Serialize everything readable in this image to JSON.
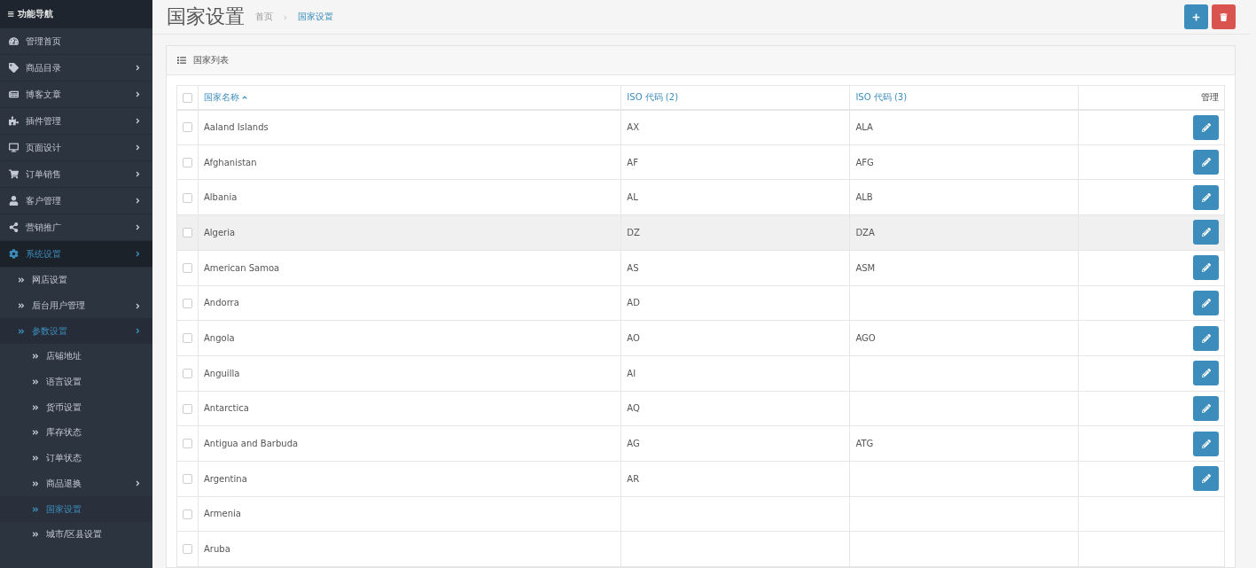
{
  "sidebar": {
    "title": "≡ 功能导航",
    "items": [
      {
        "label": "管理首页",
        "has_arrow": false,
        "selected": false
      },
      {
        "label": "商品目录",
        "has_arrow": true,
        "selected": false
      },
      {
        "label": "博客文章",
        "has_arrow": true,
        "selected": false
      },
      {
        "label": "插件管理",
        "has_arrow": true,
        "selected": false
      },
      {
        "label": "页面设计",
        "has_arrow": true,
        "selected": false
      },
      {
        "label": "订单销售",
        "has_arrow": true,
        "selected": false
      },
      {
        "label": "客户管理",
        "has_arrow": true,
        "selected": false
      },
      {
        "label": "营销推广",
        "has_arrow": true,
        "selected": false
      },
      {
        "label": "系统设置",
        "has_arrow": true,
        "selected": true,
        "children": [
          {
            "label": "网店设置",
            "has_arrow": false,
            "selected": false
          },
          {
            "label": "后台用户管理",
            "has_arrow": true,
            "selected": false
          },
          {
            "label": "参数设置",
            "has_arrow": true,
            "selected": true,
            "children": [
              {
                "label": "店铺地址",
                "has_arrow": false,
                "selected": false
              },
              {
                "label": "语言设置",
                "has_arrow": false,
                "selected": false
              },
              {
                "label": "货币设置",
                "has_arrow": false,
                "selected": false
              },
              {
                "label": "库存状态",
                "has_arrow": false,
                "selected": false
              },
              {
                "label": "订单状态",
                "has_arrow": false,
                "selected": false
              },
              {
                "label": "商品退换",
                "has_arrow": true,
                "selected": false
              },
              {
                "label": "国家设置",
                "has_arrow": false,
                "selected": true
              },
              {
                "label": "城市/区县设置",
                "has_arrow": false,
                "selected": false
              }
            ]
          }
        ]
      }
    ]
  },
  "header": {
    "title": "国家设置",
    "separator": "›",
    "breadcrumb": [
      {
        "label": "首页",
        "selected": false
      },
      {
        "label": "国家设置",
        "selected": true
      }
    ]
  },
  "panel": {
    "title": "国家列表",
    "table": {
      "all_checked": false,
      "columns": [
        {
          "label": "国家名称",
          "sorted": true
        },
        {
          "label": "ISO 代码 (2)",
          "sorted": false
        },
        {
          "label": "ISO 代码 (3)",
          "sorted": false
        },
        {
          "label": "管理",
          "sorted": false
        }
      ],
      "rows": [
        {
          "name": "Aaland Islands",
          "iso2": "AX",
          "iso3": "ALA",
          "checked": false,
          "hovered": false
        },
        {
          "name": "Afghanistan",
          "iso2": "AF",
          "iso3": "AFG",
          "checked": false,
          "hovered": false
        },
        {
          "name": "Albania",
          "iso2": "AL",
          "iso3": "ALB",
          "checked": false,
          "hovered": false
        },
        {
          "name": "Algeria",
          "iso2": "DZ",
          "iso3": "DZA",
          "checked": false,
          "hovered": true
        },
        {
          "name": "American Samoa",
          "iso2": "AS",
          "iso3": "ASM",
          "checked": false,
          "hovered": false
        },
        {
          "name": "Andorra",
          "iso2": "AD",
          "checked": false,
          "hovered": false
        },
        {
          "name": "Angola",
          "iso2": "AO",
          "iso3": "AGO",
          "checked": false,
          "hovered": false
        },
        {
          "name": "Anguilla",
          "iso2": "AI",
          "checked": false,
          "hovered": false
        },
        {
          "name": "Antarctica",
          "iso2": "AQ",
          "checked": false,
          "hovered": false
        },
        {
          "name": "Antigua and Barbuda",
          "iso2": "AG",
          "iso3": "ATG",
          "checked": false,
          "hovered": false
        },
        {
          "name": "Argentina",
          "iso2": "AR",
          "checked": false,
          "hovered": false
        },
        {
          "name": "Armenia",
          "checked": false,
          "hovered": false,
          "no_edit": true
        },
        {
          "name": "Aruba",
          "checked": false,
          "hovered": false,
          "no_edit": true
        }
      ]
    }
  }
}
